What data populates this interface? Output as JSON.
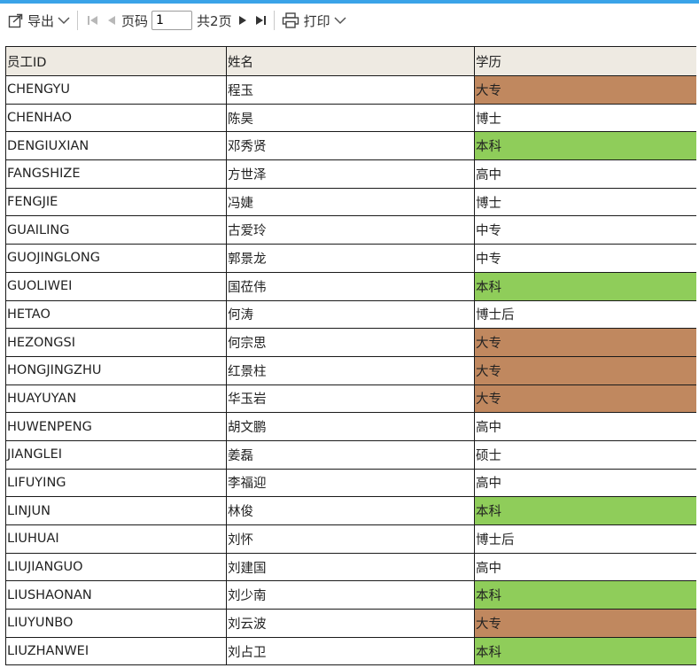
{
  "toolbar": {
    "export_label": "导出",
    "page_label": "页码",
    "page_value": "1",
    "total_pages": "共2页",
    "print_label": "打印"
  },
  "colors": {
    "accent_line": "#3aa3e8",
    "header_bg": "#eeeae2",
    "dazhuan_bg": "#c0885f",
    "benke_bg": "#8fcd5a"
  },
  "table": {
    "headers": [
      "员工ID",
      "姓名",
      "学历"
    ],
    "rows": [
      [
        "CHENGYU",
        "程玉",
        "大专"
      ],
      [
        "CHENHAO",
        "陈昊",
        "博士"
      ],
      [
        "DENGIUXIAN",
        "邓秀贤",
        "本科"
      ],
      [
        "FANGSHIZE",
        "方世泽",
        "高中"
      ],
      [
        "FENGJIE",
        "冯婕",
        "博士"
      ],
      [
        "GUAILING",
        "古爱玲",
        "中专"
      ],
      [
        "GUOJINGLONG",
        "郭景龙",
        "中专"
      ],
      [
        "GUOLIWEI",
        "国莅伟",
        "本科"
      ],
      [
        "HETAO",
        "何涛",
        "博士后"
      ],
      [
        "HEZONGSI",
        "何宗思",
        "大专"
      ],
      [
        "HONGJINGZHU",
        "红景柱",
        "大专"
      ],
      [
        "HUAYUYAN",
        "华玉岩",
        "大专"
      ],
      [
        "HUWENPENG",
        "胡文鹏",
        "高中"
      ],
      [
        "JIANGLEI",
        "姜磊",
        "硕士"
      ],
      [
        "LIFUYING",
        "李福迎",
        "高中"
      ],
      [
        "LINJUN",
        "林俊",
        "本科"
      ],
      [
        "LIUHUAI",
        "刘怀",
        "博士后"
      ],
      [
        "LIUJIANGUO",
        "刘建国",
        "高中"
      ],
      [
        "LIUSHAONAN",
        "刘少南",
        "本科"
      ],
      [
        "LIUYUNBO",
        "刘云波",
        "大专"
      ],
      [
        "LIUZHANWEI",
        "刘占卫",
        "本科"
      ]
    ]
  }
}
